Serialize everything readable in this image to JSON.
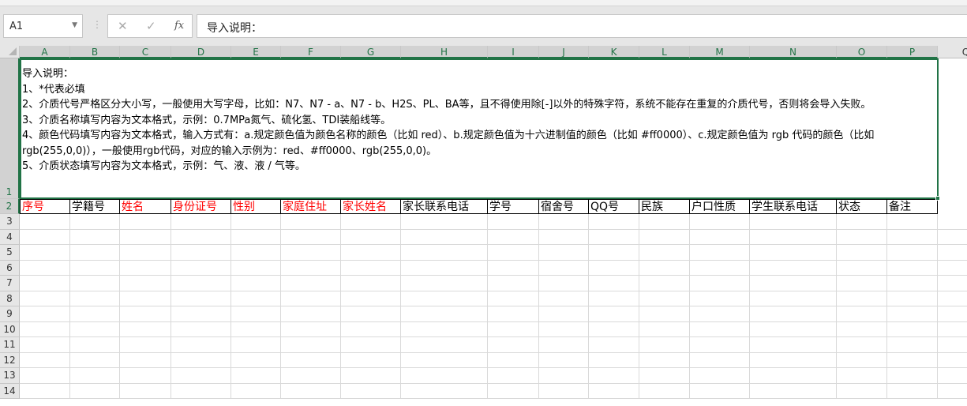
{
  "formula_bar": {
    "name_box": "A1",
    "cancel_icon": "x-icon",
    "enter_icon": "check-icon",
    "fx_label": "fx",
    "formula": "导入说明："
  },
  "columns": [
    "A",
    "B",
    "C",
    "D",
    "E",
    "F",
    "G",
    "H",
    "I",
    "J",
    "K",
    "L",
    "M",
    "N",
    "O",
    "P",
    "Q"
  ],
  "rows": [
    "1",
    "2",
    "3",
    "4",
    "5",
    "6",
    "7",
    "8",
    "9",
    "10",
    "11",
    "12",
    "13",
    "14"
  ],
  "a1_lines": [
    "导入说明：",
    "1、*代表必填",
    "2、介质代号严格区分大小写，一般使用大写字母，比如：N7、N7 - a、N7 - b、H2S、PL、BA等，且不得使用除[-]以外的特殊字符，系统不能存在重复的介质代号，否则将会导入失败。",
    "3、介质名称填写内容为文本格式，示例：0.7MPa氮气、硫化氢、TDI装船线等。",
    "4、颜色代码填写内容为文本格式，输入方式有：a.规定颜色值为颜色名称的颜色（比如 red）、b.规定颜色值为十六进制值的颜色（比如 #ff0000）、c.规定颜色值为 rgb 代码的颜色（比如 rgb(255,0,0)），一般使用rgb代码，对应的输入示例为：red、#ff0000、rgb(255,0,0)。",
    "5、介质状态填写内容为文本格式，示例：气、液、液 / 气等。"
  ],
  "headers": [
    {
      "text": "序号",
      "required": true
    },
    {
      "text": "学籍号",
      "required": false
    },
    {
      "text": "姓名",
      "required": true
    },
    {
      "text": "身份证号",
      "required": true
    },
    {
      "text": "性别",
      "required": true
    },
    {
      "text": "家庭住址",
      "required": true
    },
    {
      "text": "家长姓名",
      "required": true
    },
    {
      "text": "家长联系电话",
      "required": false
    },
    {
      "text": "学号",
      "required": false
    },
    {
      "text": "宿舍号",
      "required": false
    },
    {
      "text": "QQ号",
      "required": false
    },
    {
      "text": "民族",
      "required": false
    },
    {
      "text": "户口性质",
      "required": false
    },
    {
      "text": "学生联系电话",
      "required": false
    },
    {
      "text": "状态",
      "required": false
    },
    {
      "text": "备注",
      "required": false
    }
  ],
  "colors": {
    "accent": "#217346",
    "required": "#ff0000"
  }
}
